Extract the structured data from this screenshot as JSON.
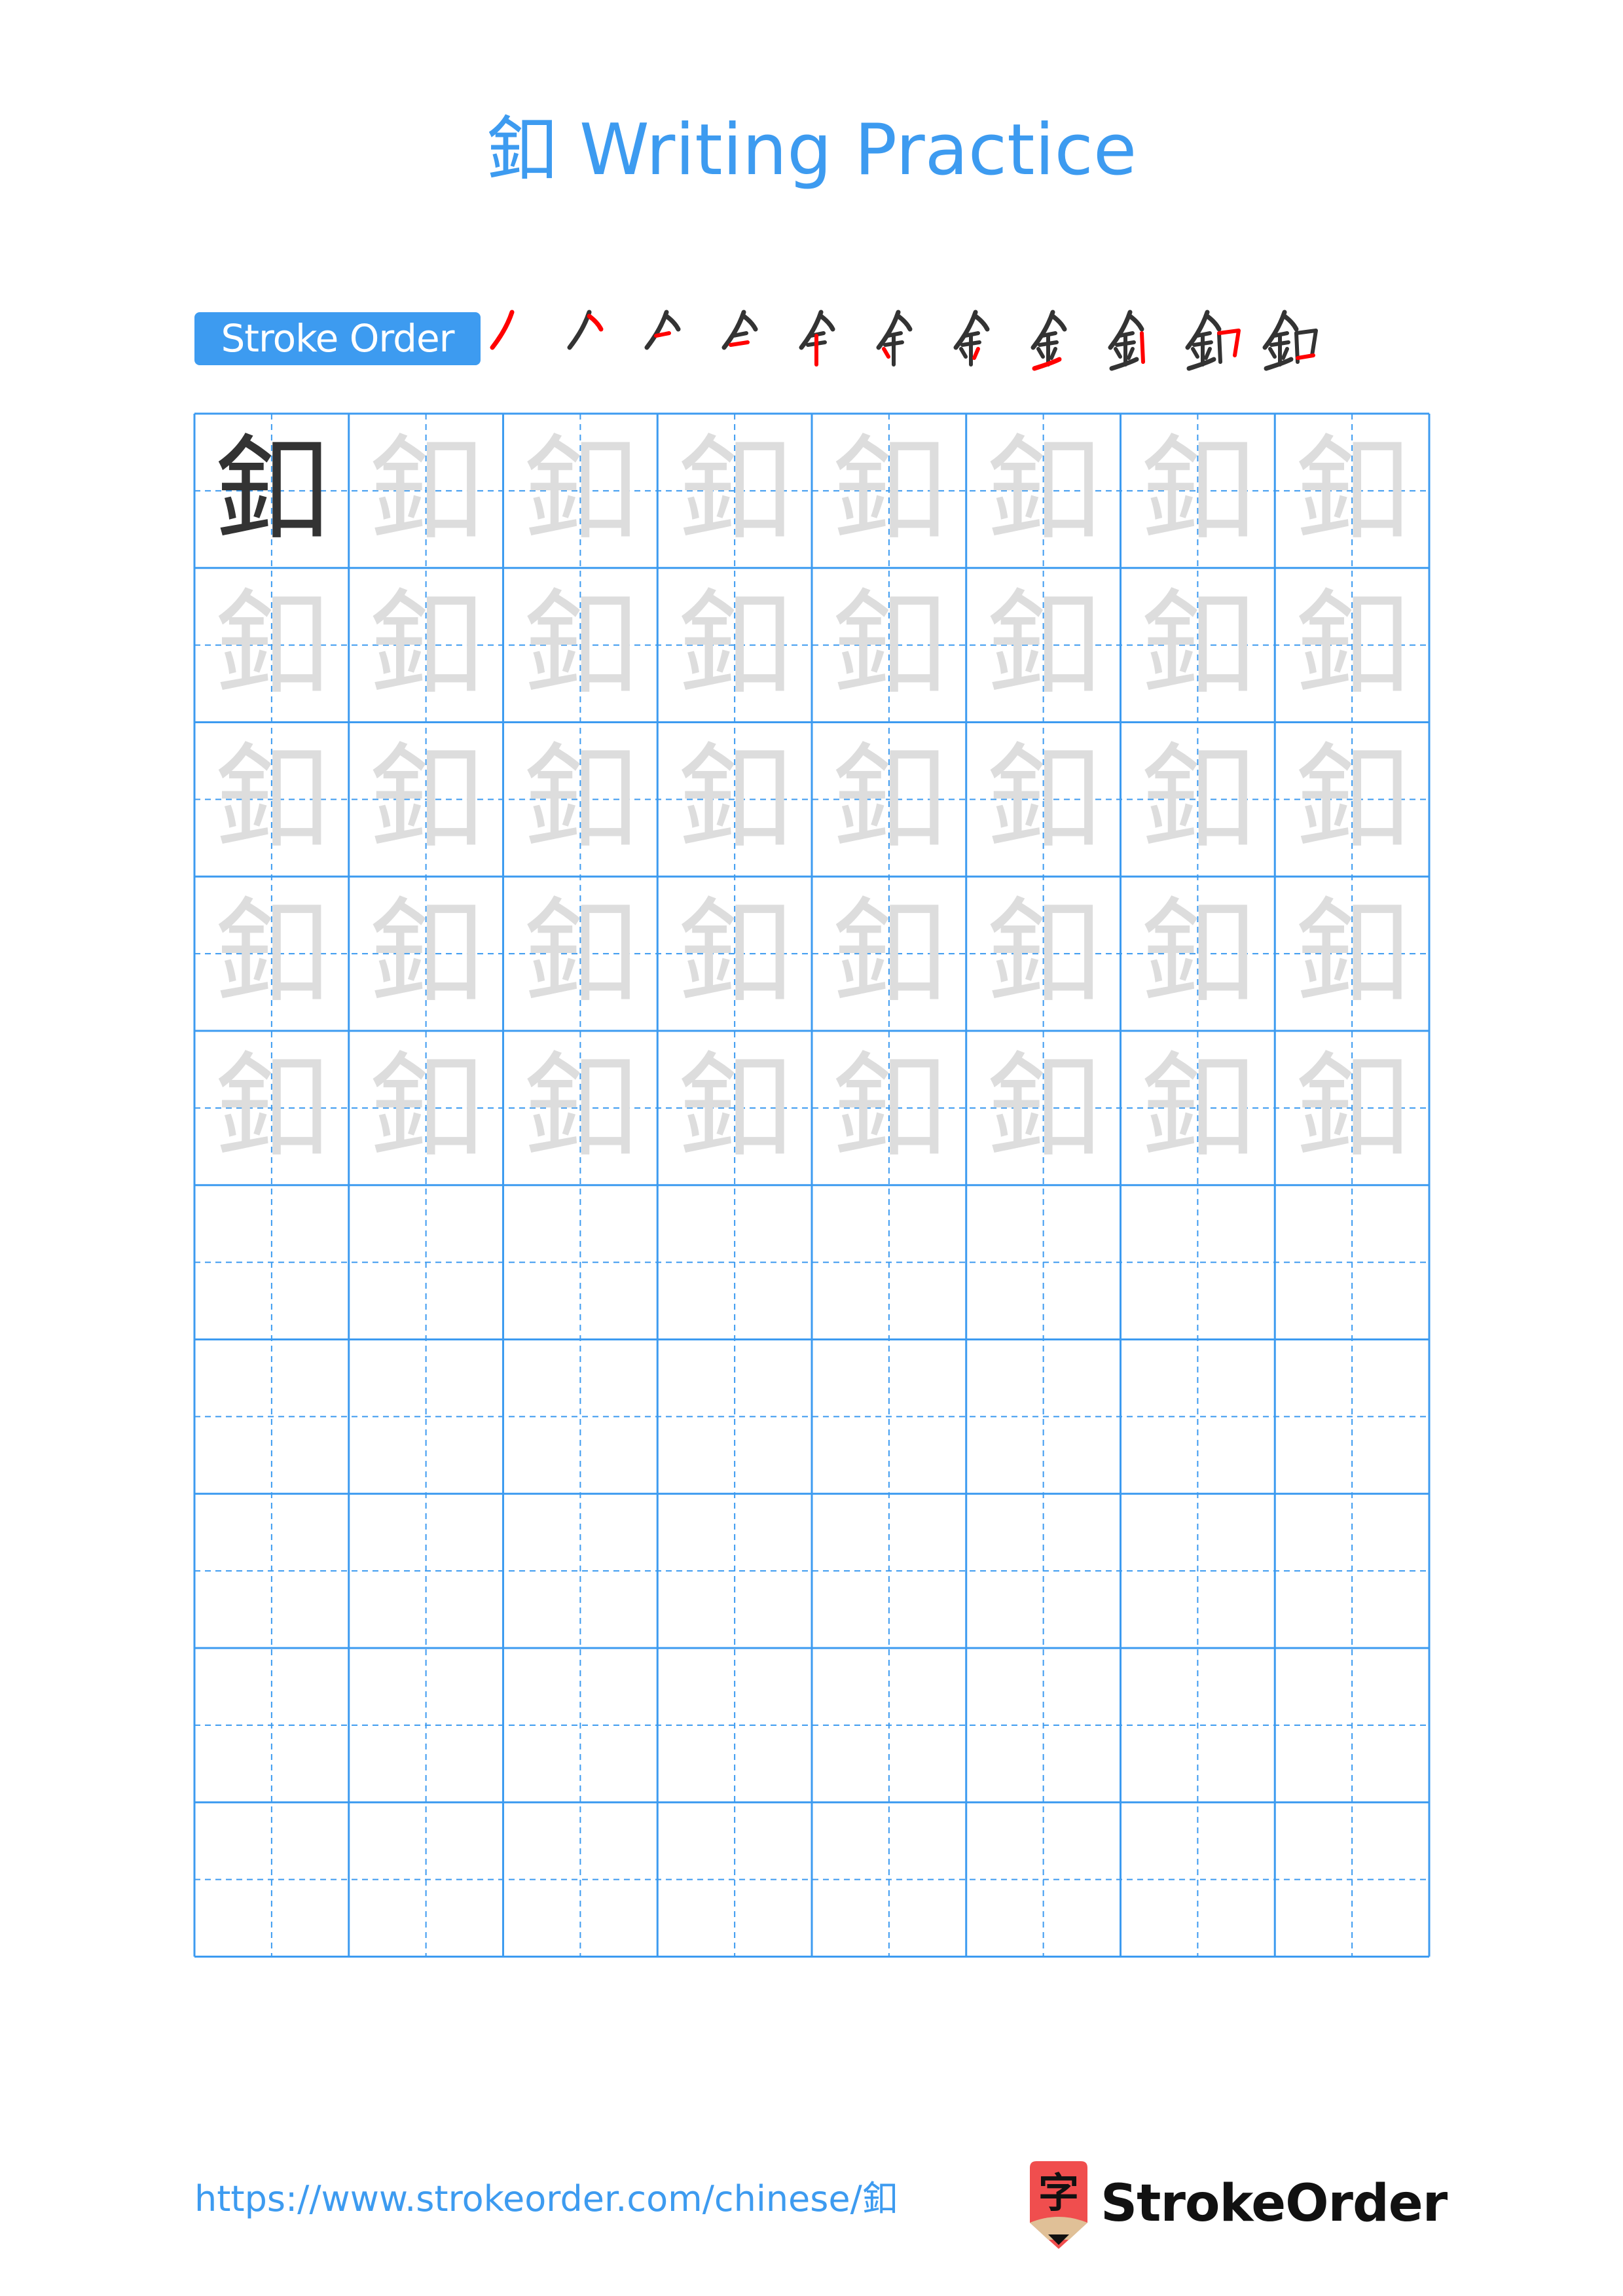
{
  "page": {
    "character": "釦",
    "title": "釦 Writing Practice"
  },
  "stroke_order": {
    "label": "Stroke Order",
    "stroke_count": 11,
    "active_stroke_color": "#ff0000",
    "done_stroke_color": "#333333"
  },
  "practice_grid": {
    "columns": 8,
    "rows": 10,
    "filled_rows": 5,
    "model_char_color": "#333333",
    "trace_char_color": "#dddddd",
    "line_color": "#3d9bf0"
  },
  "footer": {
    "url": "https://www.strokeorder.com/chinese/釦",
    "logo_glyph": "字",
    "logo_text": "StrokeOrder"
  },
  "colors": {
    "accent": "#3d9bf0",
    "logo_red": "#f04e4e",
    "logo_tan": "#e0c097"
  }
}
